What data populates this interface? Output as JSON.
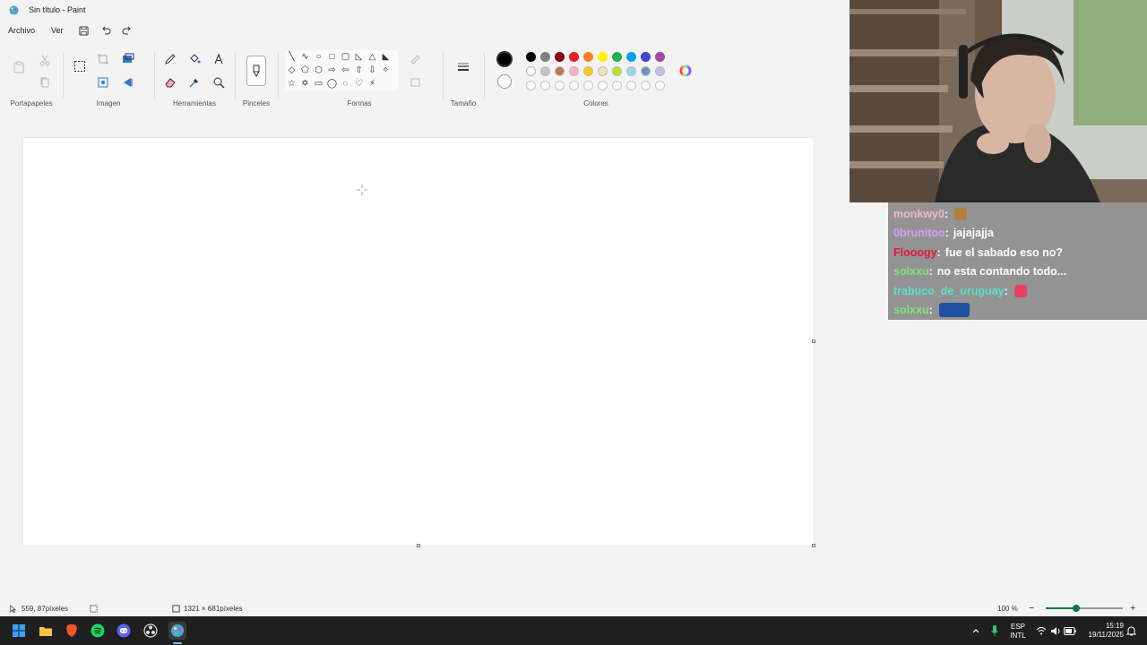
{
  "window": {
    "title": "Sin título - Paint"
  },
  "menu": {
    "file": "Archivo",
    "view": "Ver"
  },
  "ribbon": {
    "groups": {
      "clipboard": "Portapapeles",
      "image": "Imagen",
      "tools": "Herramientas",
      "brushes": "Pinceles",
      "shapes": "Formas",
      "size": "Tamaño",
      "colors": "Colores"
    },
    "shape_glyphs": [
      "╲",
      "∿",
      "○",
      "□",
      "▢",
      "◺",
      "△",
      "◣",
      "◇",
      "⬠",
      "⬡",
      "⇨",
      "⇦",
      "⇧",
      "⇩",
      "✧",
      "☆",
      "✡",
      "▭",
      "◯",
      "◌",
      "♡",
      "⚡",
      ""
    ],
    "primary_color": "#000000",
    "secondary_color": "#ffffff",
    "palette_row1": [
      "#000000",
      "#7f7f7f",
      "#880015",
      "#ed1c24",
      "#ff7f27",
      "#fff200",
      "#22b14c",
      "#00a2e8",
      "#3f48cc",
      "#a349a4"
    ],
    "palette_row2": [
      "#ffffff",
      "#c3c3c3",
      "#b97a57",
      "#ffaec9",
      "#ffc90e",
      "#efe4b0",
      "#b5e61d",
      "#99d9ea",
      "#7092be",
      "#c8bfe7"
    ]
  },
  "status": {
    "cursor_pos": "559, 87píxeles",
    "canvas_size": "1321 × 681píxeles",
    "zoom": "100 %",
    "zoom_level": 0.4
  },
  "taskbar": {
    "lang_top": "ESP",
    "lang_bottom": "INTL",
    "time": "15:19",
    "date": "19/11/2025"
  },
  "chat": [
    {
      "user": "monkwy0",
      "color": "#f3b7c6",
      "message": "",
      "emote": "#b08040"
    },
    {
      "user": "0brunitoo",
      "color": "#d4a0f0",
      "message": "jajajajja",
      "emote": ""
    },
    {
      "user": "Flooogy",
      "color": "#e0183c",
      "message": "fue el sabado eso no?",
      "emote": ""
    },
    {
      "user": "solxxu",
      "color": "#7fe37f",
      "message": "no esta contando todo...",
      "emote": ""
    },
    {
      "user": "trabuco_de_uruguay",
      "color": "#5ce0c8",
      "message": "",
      "emote": "#e84060"
    },
    {
      "user": "solxxu",
      "color": "#7fe37f",
      "message": "",
      "emote": "#2050a0"
    }
  ]
}
